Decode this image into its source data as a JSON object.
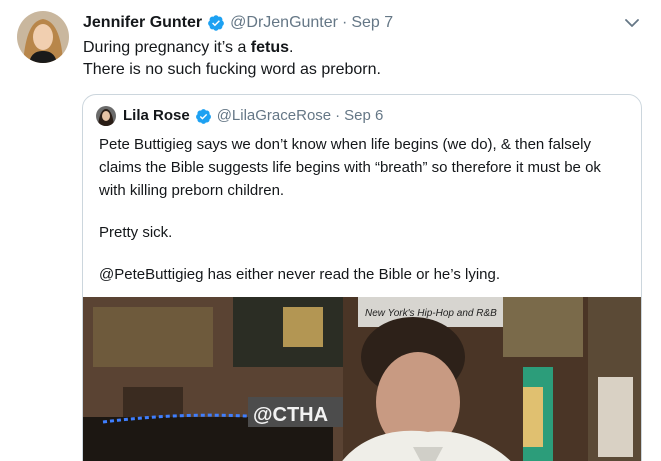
{
  "tweet": {
    "author_name": "Jennifer Gunter",
    "author_handle": "@DrJenGunter",
    "separator": "·",
    "timestamp": "Sep 7",
    "text_line1_prefix": "During pregnancy it’s a ",
    "text_line1_bold": "fetus",
    "text_line1_suffix": ".",
    "text_line2": "There is no such fucking word as preborn."
  },
  "quoted_tweet": {
    "author_name": "Lila Rose",
    "author_handle": "@LilaGraceRose",
    "separator": "·",
    "timestamp": "Sep 6",
    "paragraph1": "Pete Buttigieg says we don’t know when life begins (we do), & then falsely claims the Bible suggests life begins with “breath” so therefore it must be ok with killing preborn children.",
    "paragraph2": "Pretty sick.",
    "paragraph3": "@PeteButtigieg has either never read the Bible or he’s lying.",
    "media": {
      "sign_text": "New York's Hip-Hop and R&B",
      "watermark_text": "@CTHA"
    }
  },
  "colors": {
    "verified_blue": "#1da1f2",
    "secondary_text": "#657786",
    "border": "#ccd6dd"
  }
}
